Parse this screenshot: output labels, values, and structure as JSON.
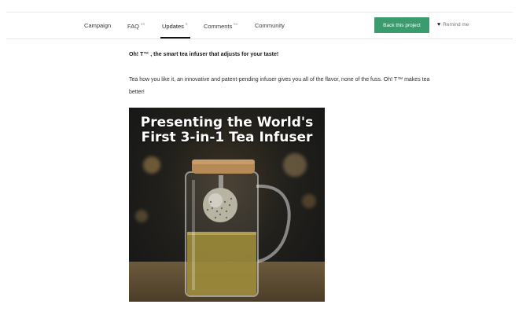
{
  "nav": {
    "tabs": [
      {
        "label": "Campaign",
        "count": ""
      },
      {
        "label": "FAQ",
        "count": "23"
      },
      {
        "label": "Updates",
        "count": "6"
      },
      {
        "label": "Comments",
        "count": "51"
      },
      {
        "label": "Community",
        "count": ""
      }
    ],
    "back_label": "Back this project",
    "remind_label": "Remind me"
  },
  "content": {
    "headline": "Oh! T™ , the smart tea infuser that adjusts for your taste!",
    "body": "Tea how you like it, an innovative and patent-pending infuser gives you all of the flavor, none of the fuss. Oh! T™ makes tea better!"
  },
  "hero": {
    "line1": "Presenting the World's",
    "line2": "First 3-in-1 Tea Infuser"
  },
  "colors": {
    "accent": "#3b9b6c",
    "active_underline": "#111111"
  },
  "icons": {
    "remind": "heart-icon"
  }
}
